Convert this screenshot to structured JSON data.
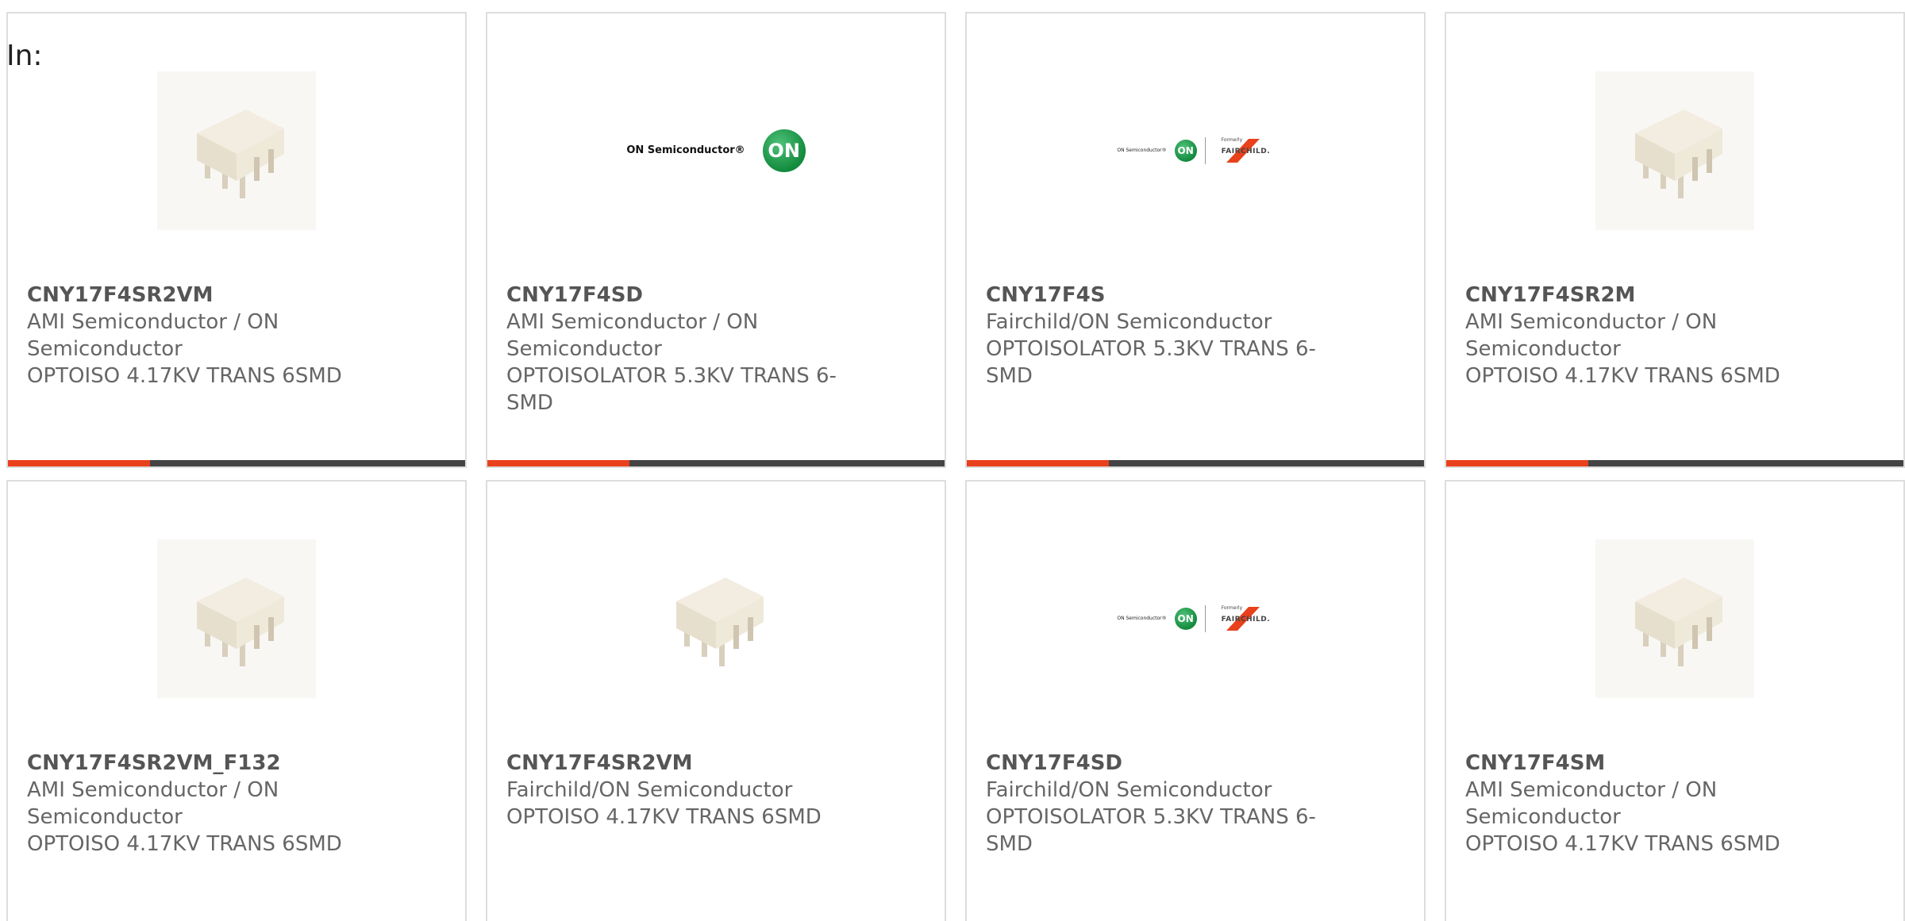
{
  "page": {
    "in_label": "In:"
  },
  "colors": {
    "accent": "#e8411c",
    "bar_dark": "#444444",
    "border": "#dddddd",
    "text": "#666666"
  },
  "products": [
    {
      "part": "CNY17F4SR2VM",
      "manufacturer": "AMI Semiconductor / ON Semiconductor",
      "description": "OPTOISO 4.17KV TRANS 6SMD",
      "image": "chip-6smd-image",
      "progress": 0.31
    },
    {
      "part": "CNY17F4SD",
      "manufacturer": "AMI Semiconductor / ON Semiconductor",
      "description": "OPTOISOLATOR 5.3KV TRANS 6-SMD",
      "image": "on-semiconductor-logo",
      "logo_text": "ON Semiconductor®",
      "logo_mark": "ON",
      "progress": 0.31
    },
    {
      "part": "CNY17F4S",
      "manufacturer": "Fairchild/ON Semiconductor",
      "description": "OPTOISOLATOR 5.3KV TRANS 6-SMD",
      "image": "on-fairchild-logo",
      "logo_text": "ON Semiconductor®",
      "logo_mark": "ON",
      "formerly": "Formerly",
      "fairchild": "FAIRCHILD.",
      "progress": 0.31
    },
    {
      "part": "CNY17F4SR2M",
      "manufacturer": "AMI Semiconductor / ON Semiconductor",
      "description": "OPTOISO 4.17KV TRANS 6SMD",
      "image": "chip-6smd-image",
      "progress": 0.31
    },
    {
      "part": "CNY17F4SR2VM_F132",
      "manufacturer": "AMI Semiconductor / ON Semiconductor",
      "description": "OPTOISO 4.17KV TRANS 6SMD",
      "image": "chip-6smd-image"
    },
    {
      "part": "CNY17F4SR2VM",
      "manufacturer": "Fairchild/ON Semiconductor",
      "description": "OPTOISO 4.17KV TRANS 6SMD",
      "image": "chip-6smd-image"
    },
    {
      "part": "CNY17F4SD",
      "manufacturer": "Fairchild/ON Semiconductor",
      "description": "OPTOISOLATOR 5.3KV TRANS 6-SMD",
      "image": "on-fairchild-logo",
      "logo_text": "ON Semiconductor®",
      "logo_mark": "ON",
      "formerly": "Formerly",
      "fairchild": "FAIRCHILD."
    },
    {
      "part": "CNY17F4SM",
      "manufacturer": "AMI Semiconductor / ON Semiconductor",
      "description": "OPTOISO 4.17KV TRANS 6SMD",
      "image": "chip-6smd-image"
    }
  ]
}
